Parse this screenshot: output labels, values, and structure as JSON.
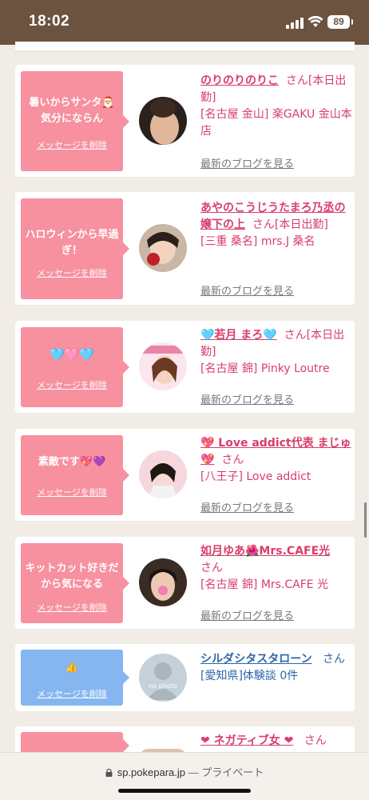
{
  "status": {
    "time": "18:02",
    "battery": "89"
  },
  "cards": [
    {
      "message": "暑いからサンタ🎅気分にならん",
      "delete_label": "メッセージを削除",
      "name": "のりのりのりこ",
      "san": "さん",
      "status": "[本日出勤]",
      "address": "[名古屋 金山] 楽GAKU 金山本店",
      "blog": "最新のブログを見る",
      "color": "#f7909f"
    },
    {
      "message": "ハロウィンから早過ぎ！",
      "delete_label": "メッセージを削除",
      "name": "あやのこうじうたまろ乃丞の嬢下の上",
      "san": "さん",
      "status": "[本日出勤]",
      "address": "[三重 桑名] mrs.J 桑名",
      "blog": "最新のブログを見る",
      "color": "#f7909f"
    },
    {
      "message": "🩵🩷🩵",
      "delete_label": "メッセージを削除",
      "name": "🩵若月 まろ🩵",
      "san": "さん",
      "status": "[本日出勤]",
      "address": "[名古屋 錦] Pinky Loutre",
      "blog": "最新のブログを見る",
      "color": "#f7909f"
    },
    {
      "message": "素敵です💖💜",
      "delete_label": "メッセージを削除",
      "name": "💖 Love addict代表 まじゅ 💖",
      "san": "さん",
      "status": "",
      "address": "[八王子] Love addict",
      "blog": "最新のブログを見る",
      "color": "#f7909f"
    },
    {
      "message": "キットカット好きだから気になる",
      "delete_label": "メッセージを削除",
      "name": "如月ゆあ🌺Mrs.CAFE光",
      "san": "さん",
      "status": "",
      "address": "[名古屋 錦] Mrs.CAFE 光",
      "blog": "最新のブログを見る",
      "color": "#f7909f"
    },
    {
      "message": "👍",
      "delete_label": "メッセージを削除",
      "name": "シルダシタスタローン",
      "san": "さん",
      "status": "",
      "address": "[愛知県]体験談 0件",
      "blog": "",
      "avatar_text": "no photo",
      "color": "#85b6f0"
    },
    {
      "message": "",
      "delete_label": "",
      "name": "❤ ネガティブ女 ❤",
      "san": "さん",
      "status": "",
      "address": "",
      "blog": "",
      "color": "#f7909f"
    }
  ],
  "browser": {
    "domain": "sp.pokepara.jp",
    "separator": "—",
    "private_label": "プライベート"
  }
}
